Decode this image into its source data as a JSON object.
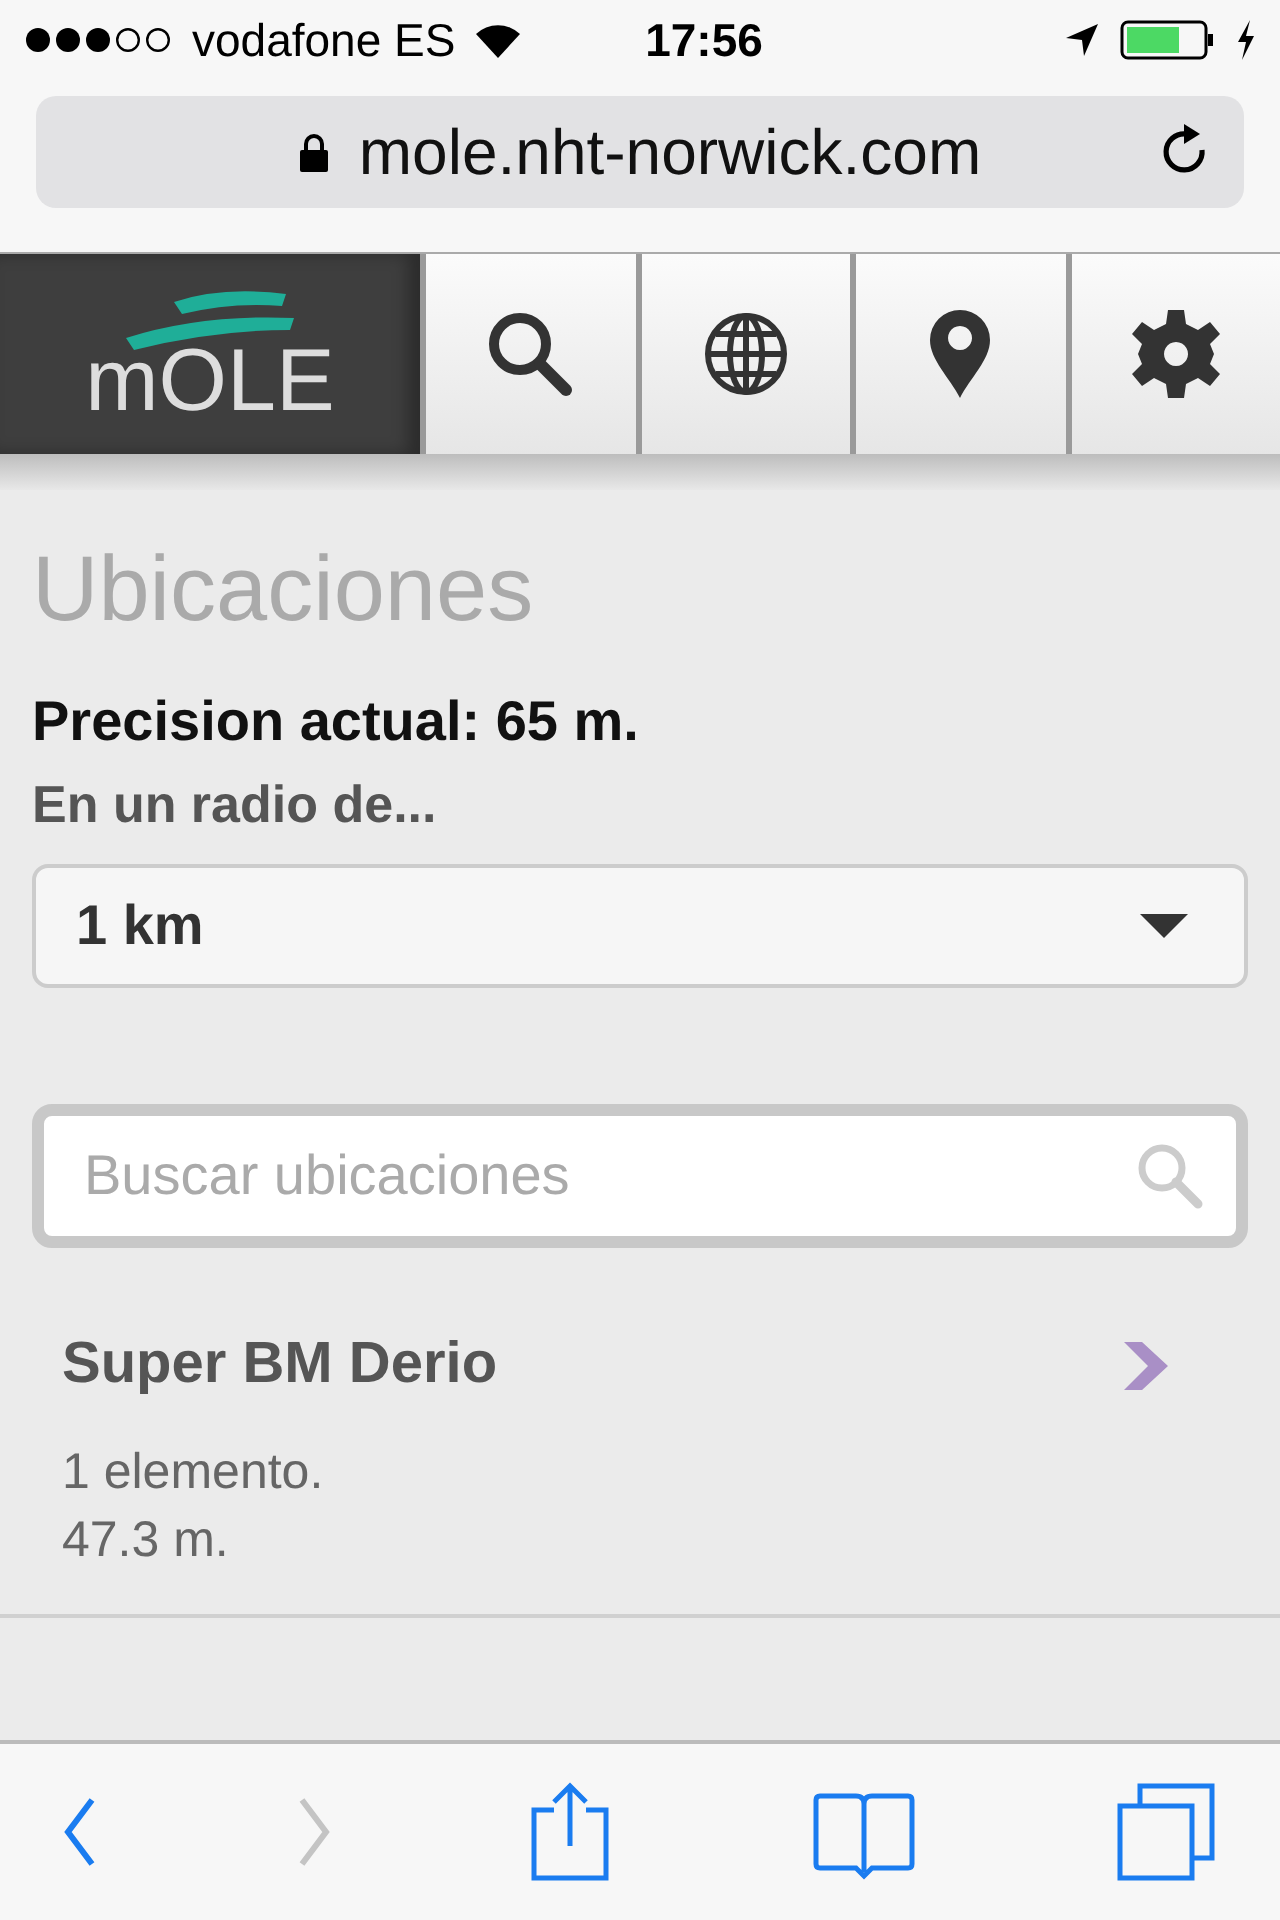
{
  "status_bar": {
    "carrier": "vodafone ES",
    "time": "17:56"
  },
  "browser": {
    "url": "mole.nht-norwick.com"
  },
  "app_header": {
    "logo": "mOLE",
    "nav": [
      {
        "kind": "search"
      },
      {
        "kind": "globe"
      },
      {
        "kind": "pin"
      },
      {
        "kind": "settings"
      }
    ]
  },
  "page": {
    "title": "Ubicaciones",
    "precision": "Precision actual: 65 m.",
    "radius_label": "En un radio de...",
    "radius": {
      "value": "1 km"
    },
    "search": {
      "placeholder": "Buscar ubicaciones"
    },
    "locations": [
      {
        "name": "Super BM Derio",
        "count": "1 elemento.",
        "distance": "47.3 m."
      }
    ]
  },
  "toolbar": [
    {
      "kind": "back",
      "disabled": false
    },
    {
      "kind": "forward",
      "disabled": true
    },
    {
      "kind": "share",
      "disabled": false
    },
    {
      "kind": "bookmarks",
      "disabled": false
    },
    {
      "kind": "tabs",
      "disabled": false
    }
  ]
}
